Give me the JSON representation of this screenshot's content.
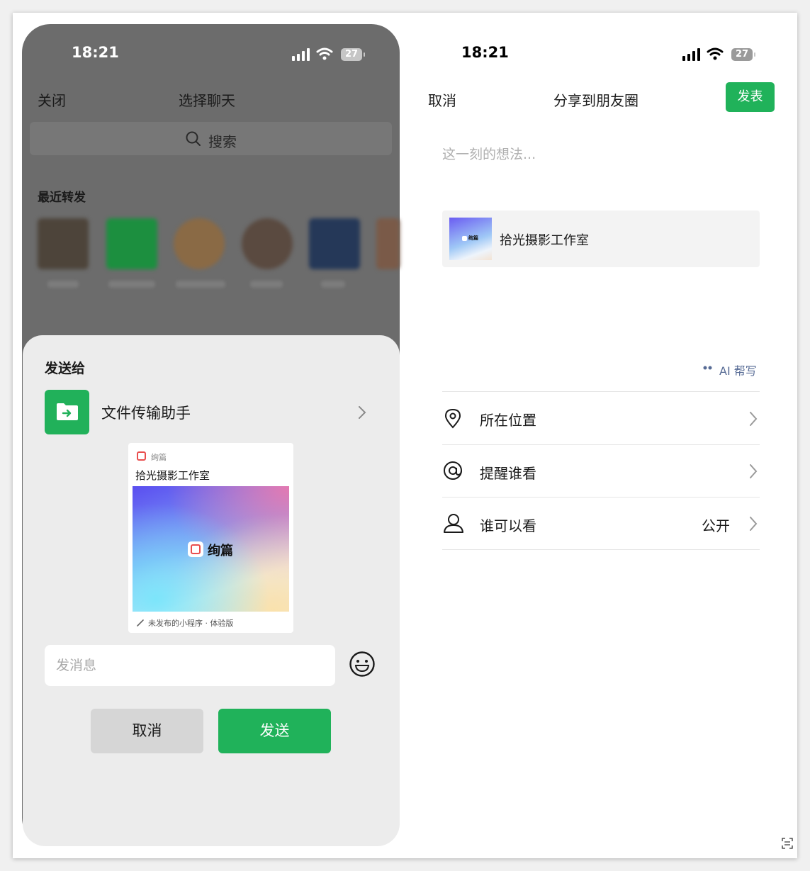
{
  "left": {
    "status": {
      "time": "18:21",
      "battery": "27"
    },
    "nav": {
      "close": "关闭",
      "title": "选择聊天"
    },
    "search": {
      "placeholder": "搜索"
    },
    "recent": {
      "title": "最近转发"
    },
    "sheet": {
      "title": "发送给",
      "recipient": "文件传输助手",
      "card": {
        "app_name": "绚篇",
        "title": "拾光摄影工作室",
        "brand": "绚篇",
        "footer": "未发布的小程序 · 体验版"
      },
      "message_placeholder": "发消息",
      "cancel": "取消",
      "send": "发送"
    }
  },
  "right": {
    "status": {
      "time": "18:21",
      "battery": "27"
    },
    "nav": {
      "cancel": "取消",
      "title": "分享到朋友圈",
      "publish": "发表"
    },
    "thought_placeholder": "这一刻的想法...",
    "share_card": {
      "title": "拾光摄影工作室",
      "thumb_text": "绚篇"
    },
    "ai_help": "AI 帮写",
    "rows": [
      {
        "label": "所在位置",
        "icon": "location-pin-icon"
      },
      {
        "label": "提醒谁看",
        "icon": "at-icon"
      },
      {
        "label": "谁可以看",
        "value": "公开",
        "icon": "person-icon"
      }
    ]
  },
  "colors": {
    "accent_green": "#07C160",
    "dim_overlay": "#6c6c6c",
    "link_blue": "#576b95"
  }
}
